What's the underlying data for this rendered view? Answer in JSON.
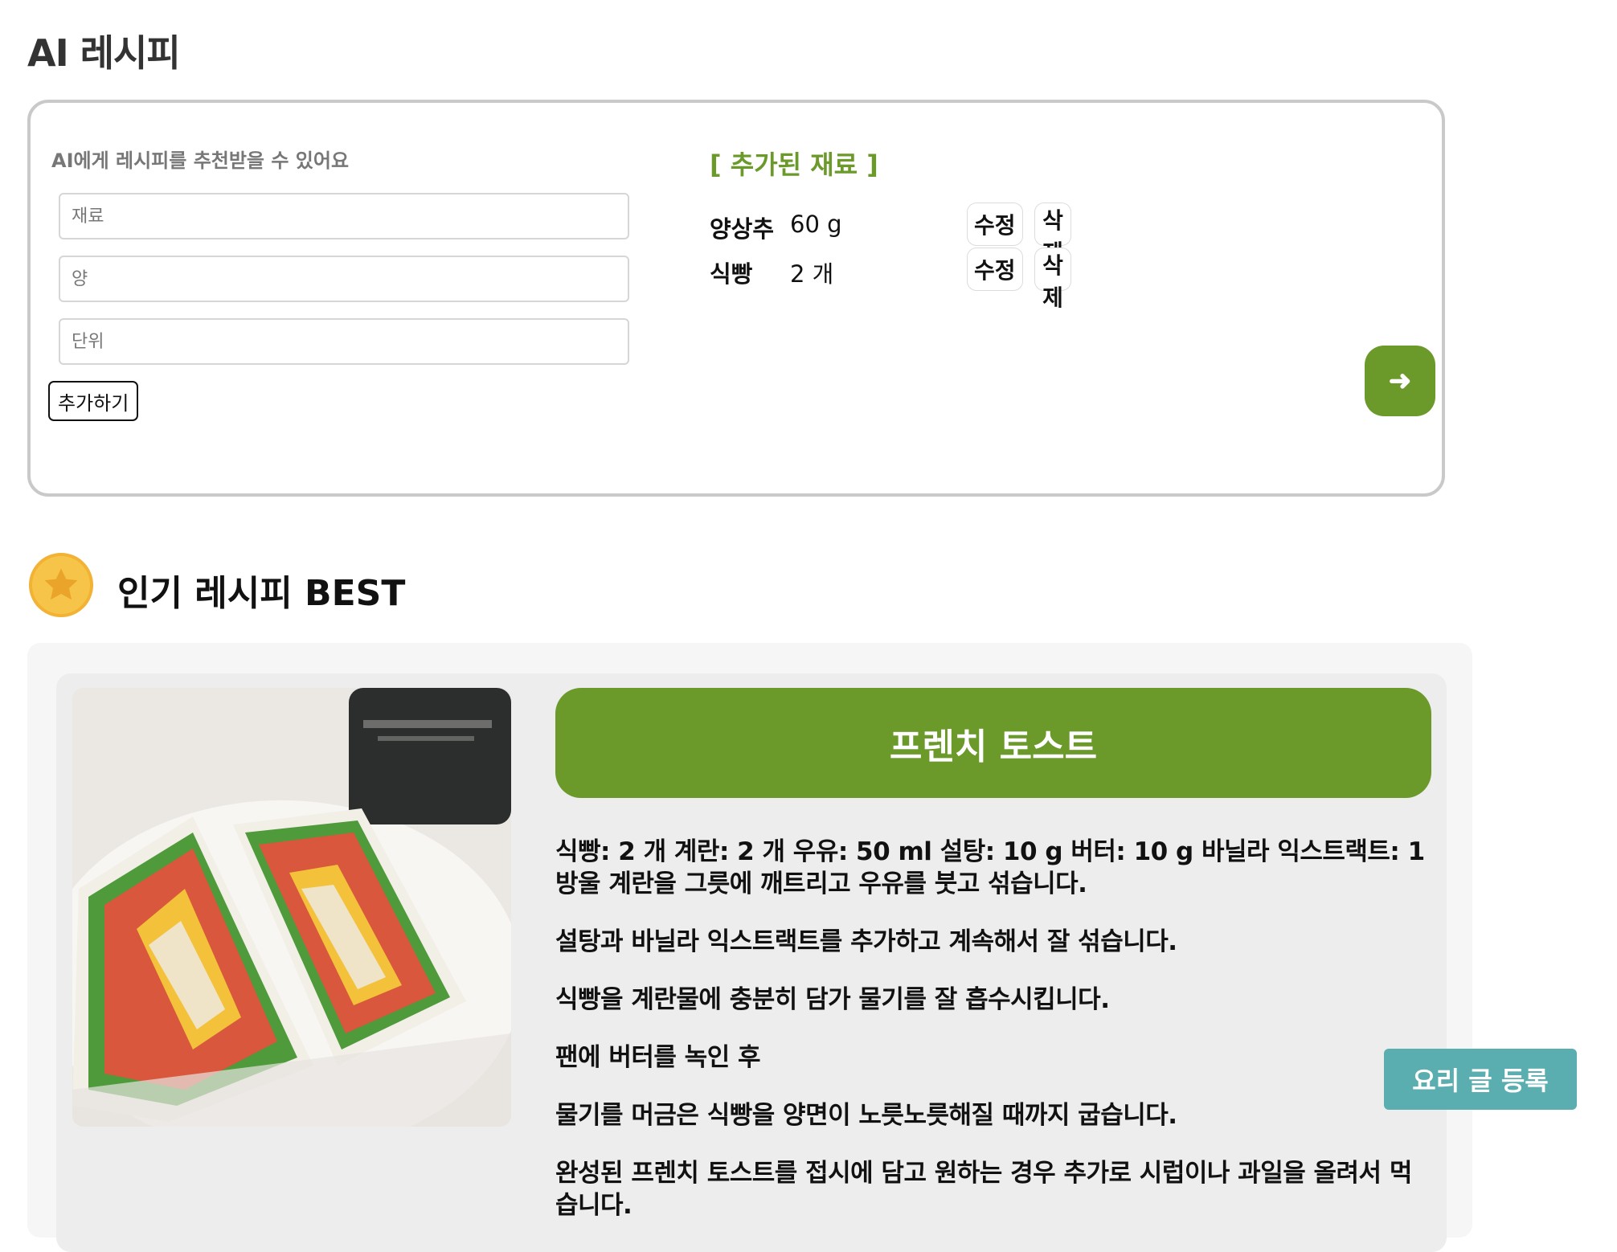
{
  "page_title": "AI 레시피",
  "ai_form": {
    "description": "AI에게 레시피를 추천받을 수 있어요",
    "ingredient_placeholder": "재료",
    "amount_placeholder": "양",
    "unit_placeholder": "단위",
    "add_label": "추가하기",
    "added_title": "[ 추가된 재료 ]",
    "ingredients": [
      {
        "name": "양상추",
        "qty": "60 g",
        "edit": "수정",
        "delete": "삭제"
      },
      {
        "name": "식빵",
        "qty": "2 개",
        "edit": "수정",
        "delete": "삭제"
      }
    ],
    "submit_icon": "arrow-right-icon",
    "submit_label": "➜"
  },
  "best": {
    "title": "인기 레시피 BEST",
    "medal_icon": "star-medal-icon",
    "recipe": {
      "name": "프렌치 토스트",
      "steps": [
        "식빵: 2 개 계란: 2 개 우유: 50 ml 설탕: 10 g 버터: 10 g 바닐라 익스트랙트: 1 방울 계란을 그릇에 깨트리고 우유를 붓고 섞습니다.",
        "설탕과 바닐라 익스트랙트를 추가하고 계속해서 잘 섞습니다.",
        "식빵을 계란물에 충분히 담가 물기를 잘 흡수시킵니다.",
        "팬에 버터를 녹인 후",
        "물기를 머금은 식빵을 양면이 노릇노릇해질 때까지 굽습니다.",
        "완성된 프렌치 토스트를 접시에 담고 원하는 경우 추가로 시럽이나 과일을 올려서 먹습니다."
      ]
    }
  },
  "floating_button": {
    "label": "요리 글 등록"
  },
  "colors": {
    "accent_green": "#6b9a2a",
    "teal": "#5aaeb0",
    "medal": "#f7c44a"
  }
}
